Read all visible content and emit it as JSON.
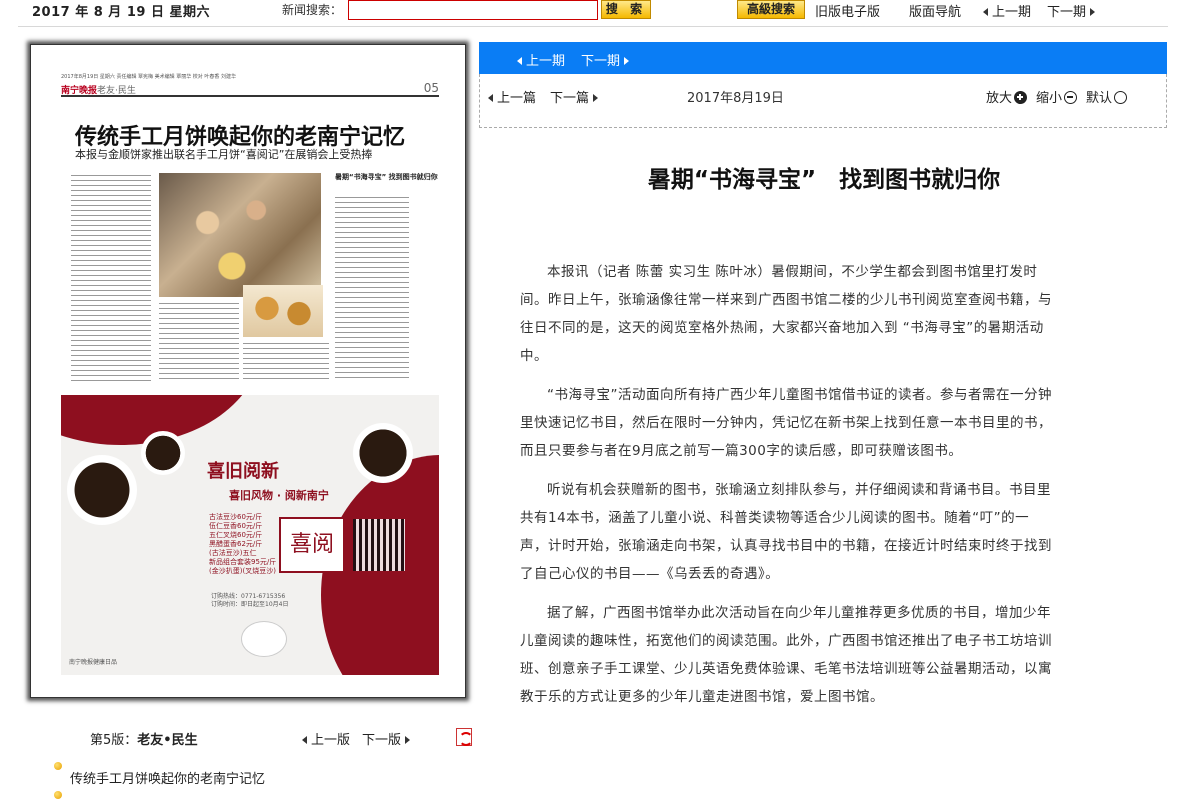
{
  "topbar": {
    "date": "2017 年 8 月 19 日 星期六",
    "search_label": "新闻搜索：",
    "search_value": "",
    "search_button": "搜 索",
    "advanced_search_button": "高級搜索",
    "old_version_link": "旧版电子版",
    "layout_nav_link": "版面导航",
    "prev_issue_link": "上一期",
    "next_issue_link": "下一期"
  },
  "newspaper": {
    "header_tiny": "2017年8月19日 星期六 责任编辑 覃宪梅 美术编辑 覃丽华 校对 叶春香 刘建华",
    "logo": "南宁晚报",
    "section": "老友·民生",
    "page_number": "05",
    "headline": "传统手工月饼唤起你的老南宁记忆",
    "subhead": "本报与金顺饼家推出联名手工月饼“喜阅记”在展销会上受热捧",
    "side_title": "暑期“书海寻宝” 找到图书就归你",
    "ad_title": "喜旧阅新",
    "ad_subtitle": "喜旧风物 · 阅新南宁",
    "ad_prices": [
      "古法豆沙60元/斤",
      "伍仁豆香60元/斤",
      "五仁叉烧60元/斤",
      "黑醋蛋香62元/斤",
      "(古法豆沙)五仁",
      "新品组合套装95元/斤",
      "(金沙扒蛋)(叉烧豆沙)"
    ],
    "ad_logo": "喜阅",
    "ad_info": [
      "订购热线：0771-6715356",
      "订购时间：即日起至10月4日"
    ],
    "ad_footer": "南宁晚报健康日品"
  },
  "below_paper": {
    "edition_prefix": "第5版：",
    "edition_name": "老友•民生",
    "prev_page": "上一版",
    "next_page": "下一版",
    "story_link": "传统手工月饼唤起你的老南宁记忆"
  },
  "article_nav": {
    "prev_issue": "上一期",
    "next_issue": "下一期",
    "prev_article": "上一篇",
    "next_article": "下一篇",
    "date": "2017年8月19日",
    "zoom_in": "放大",
    "zoom_out": "缩小",
    "zoom_default": "默认"
  },
  "article": {
    "title": "暑期“书海寻宝”　找到图书就归你",
    "paragraphs": [
      "本报讯（记者 陈蕾 实习生 陈叶冰）暑假期间，不少学生都会到图书馆里打发时间。昨日上午，张瑜涵像往常一样来到广西图书馆二楼的少儿书刊阅览室查阅书籍，与往日不同的是，这天的阅览室格外热闹，大家都兴奋地加入到 “书海寻宝”的暑期活动中。",
      "“书海寻宝”活动面向所有持广西少年儿童图书馆借书证的读者。参与者需在一分钟里快速记忆书目，然后在限时一分钟内，凭记忆在新书架上找到任意一本书目里的书，而且只要参与者在9月底之前写一篇300字的读后感，即可获赠该图书。",
      "听说有机会获赠新的图书，张瑜涵立刻排队参与，并仔细阅读和背诵书目。书目里共有14本书，涵盖了儿童小说、科普类读物等适合少儿阅读的图书。随着“叮”的一声，计时开始，张瑜涵走向书架，认真寻找书目中的书籍，在接近计时结束时终于找到了自己心仪的书目——《乌丢丢的奇遇》。",
      "据了解，广西图书馆举办此次活动旨在向少年儿童推荐更多优质的书目，增加少年儿童阅读的趣味性，拓宽他们的阅读范围。此外，广西图书馆还推出了电子书工坊培训班、创意亲子手工课堂、少儿英语免费体验课、毛笔书法培训班等公益暑期活动，以寓教于乐的方式让更多的少年儿童走进图书馆，爱上图书馆。"
    ]
  },
  "colors": {
    "accent_blue": "#0a7df5",
    "button_yellow": "#f5b800",
    "ad_red": "#8e0f1f"
  }
}
